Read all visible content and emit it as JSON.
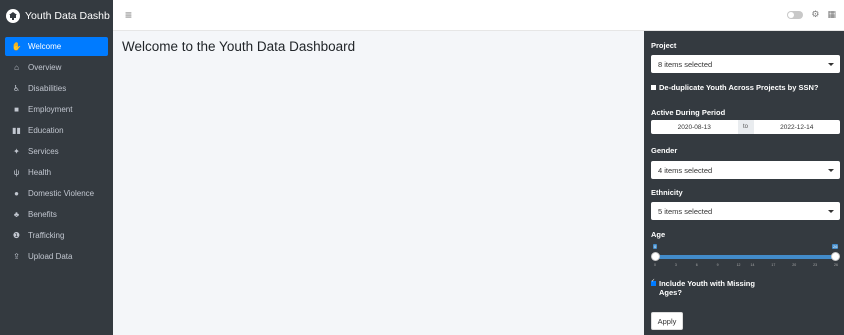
{
  "app": {
    "title": "Youth Data Dashb"
  },
  "topbar": {
    "menu_icon": "bars-icon",
    "icons": [
      "theme-toggle",
      "gear-icon",
      "grid-icon"
    ]
  },
  "sidebar": {
    "items": [
      {
        "label": "Welcome",
        "icon": "hand-wave-icon",
        "active": true
      },
      {
        "label": "Overview",
        "icon": "home-icon"
      },
      {
        "label": "Disabilities",
        "icon": "wheelchair-icon"
      },
      {
        "label": "Employment",
        "icon": "briefcase-icon"
      },
      {
        "label": "Education",
        "icon": "book-icon"
      },
      {
        "label": "Services",
        "icon": "handshake-icon"
      },
      {
        "label": "Health",
        "icon": "stethoscope-icon"
      },
      {
        "label": "Domestic Violence",
        "icon": "users-icon"
      },
      {
        "label": "Benefits",
        "icon": "hand-holding-icon"
      },
      {
        "label": "Trafficking",
        "icon": "exclamation-circle-icon"
      },
      {
        "label": "Upload Data",
        "icon": "upload-icon"
      }
    ]
  },
  "main": {
    "title": "Welcome to the Youth Data Dashboard"
  },
  "controls": {
    "project": {
      "label": "Project",
      "value": "8 items selected"
    },
    "dedupe": {
      "label": "De-duplicate Youth Across Projects by SSN?",
      "checked": false
    },
    "period": {
      "label": "Active During Period",
      "start": "2020-08-13",
      "sep": "to",
      "end": "2022-12-14"
    },
    "gender": {
      "label": "Gender",
      "value": "4 items selected"
    },
    "ethnicity": {
      "label": "Ethnicity",
      "value": "5 items selected"
    },
    "age": {
      "label": "Age",
      "min": 0,
      "max": 26,
      "from": 0,
      "to": 26,
      "from_label": "0",
      "to_label": "26",
      "ticks": [
        "0",
        "3",
        "6",
        "9",
        "12",
        "14",
        "17",
        "20",
        "23",
        "26"
      ]
    },
    "include_missing": {
      "label_line1": "Include Youth with Missing",
      "label_line2": "Ages?",
      "checked": true
    },
    "apply_label": "Apply"
  },
  "colors": {
    "sidebar_bg": "#343a40",
    "accent": "#007bff",
    "slider": "#428bca",
    "main_bg": "#f4f6f9"
  }
}
